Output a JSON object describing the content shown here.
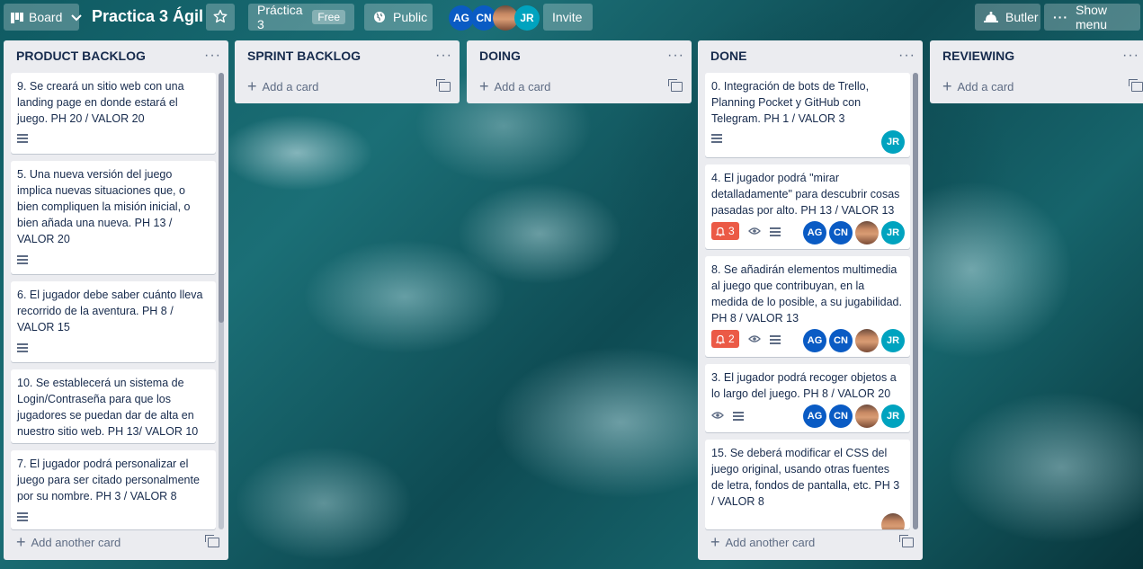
{
  "header": {
    "board_switcher": "Board",
    "board_title": "Practica 3 Ágil",
    "team_name": "Práctica 3",
    "team_plan": "Free",
    "visibility": "Public",
    "members": [
      "AG",
      "CN",
      "",
      "JR"
    ],
    "invite": "Invite",
    "butler": "Butler",
    "show_menu": "Show menu"
  },
  "lists": [
    {
      "title": "PRODUCT BACKLOG",
      "add": "Add another card",
      "cards": [
        {
          "text": "9. Se creará un sitio web con una landing page en donde estará el juego. PH 20 / VALOR 20"
        },
        {
          "text": "5. Una nueva versión del juego implica nuevas situaciones que, o bien compliquen la misión inicial, o bien añada una nueva. PH 13 / VALOR 20"
        },
        {
          "text": "6. El jugador debe saber cuánto lleva recorrido de la aventura. PH 8 / VALOR 15"
        },
        {
          "text": "10. Se establecerá un sistema de Login/Contraseña para que los jugadores se puedan dar de alta en nuestro sitio web. PH 13/ VALOR 10"
        },
        {
          "text": "7. El jugador podrá personalizar el juego para ser citado personalmente por su nombre. PH 3 / VALOR 8"
        }
      ]
    },
    {
      "title": "SPRINT BACKLOG",
      "add": "Add a card",
      "cards": []
    },
    {
      "title": "DOING",
      "add": "Add a card",
      "cards": []
    },
    {
      "title": "DONE",
      "add": "Add another card",
      "cards": [
        {
          "text": "0. Integración de bots de Trello, Planning Pocket y GitHub con Telegram. PH 1 / VALOR 3",
          "members": [
            "JR"
          ]
        },
        {
          "text": "4. El jugador podrá \"mirar detalladamente\" para descubrir cosas pasadas por alto. PH 13 / VALOR 13",
          "notifications": "3",
          "members": [
            "AG",
            "CN",
            "",
            "JR"
          ]
        },
        {
          "text": "8. Se añadirán elementos multimedia al juego que contribuyan, en la medida de lo posible, a su jugabilidad. PH 8 / VALOR 13",
          "notifications": "2",
          "members": [
            "AG",
            "CN",
            "",
            "JR"
          ]
        },
        {
          "text": "3. El jugador podrá recoger objetos a lo largo del juego. PH 8 / VALOR 20",
          "members": [
            "AG",
            "CN",
            "",
            "JR"
          ]
        },
        {
          "text": "15. Se deberá modificar el CSS del juego original, usando otras fuentes de letra, fondos de pantalla, etc. PH 3 / VALOR 8"
        }
      ]
    },
    {
      "title": "REVIEWING",
      "add": "Add a card",
      "cards": []
    }
  ],
  "colors": {
    "list_bg": "#ebecf0",
    "member_blue": "#0a5bc4",
    "member_teal": "#00a3bf",
    "notification_red": "#eb5a46"
  },
  "icons": [
    "board-icon",
    "chevron-down-icon",
    "star-icon",
    "globe-icon",
    "bell-icon",
    "eye-icon",
    "description-icon",
    "template-icon",
    "plus-icon",
    "more-icon",
    "butler-icon"
  ]
}
